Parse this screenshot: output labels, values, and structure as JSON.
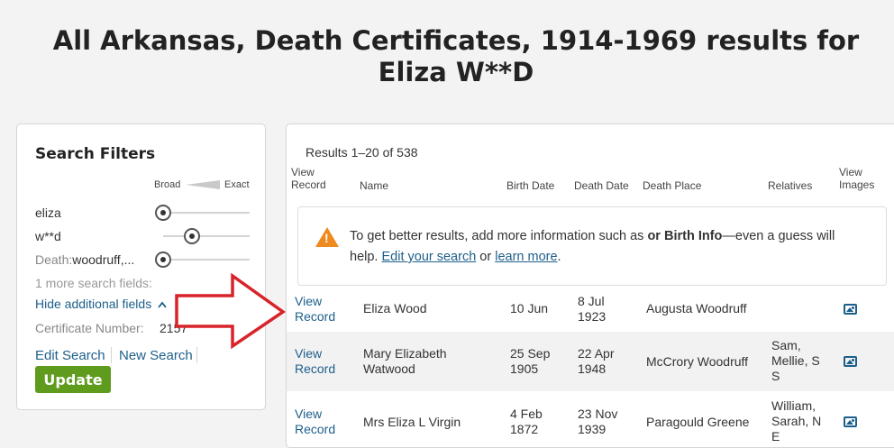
{
  "page": {
    "title": "All Arkansas, Death Certificates, 1914-1969 results for Eliza W**D"
  },
  "filters": {
    "title": "Search Filters",
    "scale_broad": "Broad",
    "scale_exact": "Exact",
    "first_name": "eliza",
    "last_name": "w**d",
    "death_label": "Death:",
    "death_value": "woodruff,...",
    "more_fields": "1 more search fields:",
    "hide_fields": "Hide additional fields",
    "certificate_label": "Certificate Number:",
    "certificate_value": "2157",
    "edit_search": "Edit Search",
    "new_search": "New Search",
    "update": "Update"
  },
  "results": {
    "count": "Results 1–20 of 538",
    "columns": {
      "view_record": "View Record",
      "name": "Name",
      "birth_date": "Birth Date",
      "death_date": "Death Date",
      "death_place": "Death Place",
      "relatives": "Relatives",
      "view_images": "View Images"
    },
    "notice": {
      "text_before": "To get better results, add more information such as ",
      "bold": "or Birth Info",
      "text_after": "—even a guess will help. ",
      "link1": "Edit your search",
      "or": " or ",
      "link2": "learn more",
      "end": "."
    },
    "rows": [
      {
        "view": "View Record",
        "name": "Eliza Wood",
        "birth": "10 Jun",
        "death": "8 Jul 1923",
        "place": "Augusta Woodruff",
        "relatives": ""
      },
      {
        "view": "View Record",
        "name": "Mary Elizabeth Watwood",
        "birth": "25 Sep 1905",
        "death": "22 Apr 1948",
        "place": "McCrory Woodruff",
        "relatives": "Sam, Mellie, S S"
      },
      {
        "view": "View Record",
        "name": "Mrs Eliza L Virgin",
        "birth": "4 Feb 1872",
        "death": "23 Nov 1939",
        "place": "Paragould Greene",
        "relatives": "William, Sarah, N E"
      }
    ]
  },
  "colors": {
    "link": "#1d5f8a",
    "update_button": "#5f9b1d",
    "warning": "#ee8a1e",
    "arrow": "#d9232a"
  },
  "icons": {
    "warning": "warning-icon",
    "image": "image-icon",
    "chevron": "chevron-up-icon"
  }
}
